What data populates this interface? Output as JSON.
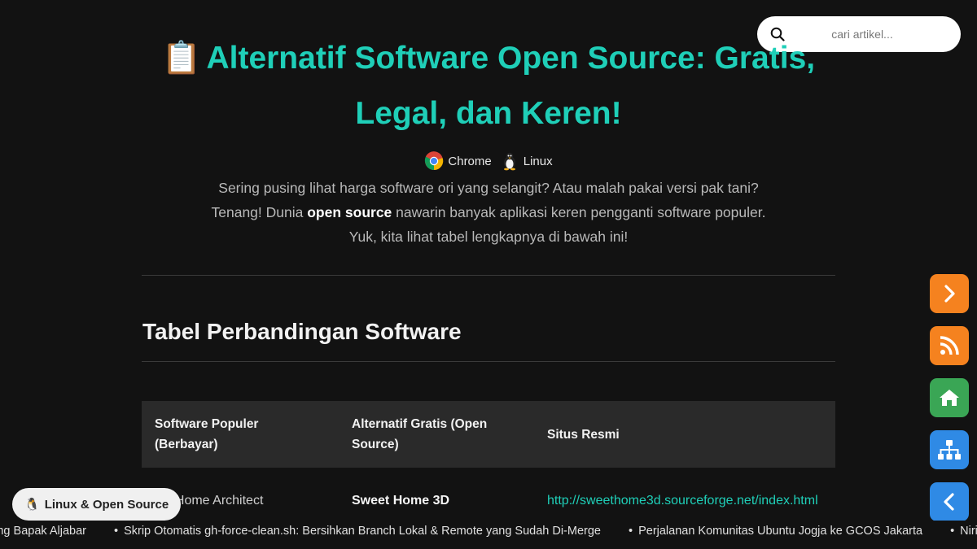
{
  "search": {
    "placeholder": "cari artikel..."
  },
  "page": {
    "title_emoji": "📋",
    "title": "Alternatif Software Open Source: Gratis, Legal, dan Keren!",
    "tags": [
      {
        "label": "Chrome",
        "icon": "chrome-icon"
      },
      {
        "label": "Linux",
        "icon": "tux-penguin-icon"
      }
    ],
    "intro_before": "Sering pusing lihat harga software ori yang selangit? Atau malah pakai versi pak tani? Tenang! Dunia ",
    "intro_bold": "open source",
    "intro_after": " nawarin banyak aplikasi keren pengganti software populer. Yuk, kita lihat tabel lengkapnya di bawah ini!",
    "section_title": "Tabel Perbandingan Software"
  },
  "table": {
    "headers": [
      "Software Populer (Berbayar)",
      "Alternatif Gratis (Open Source)",
      "Situs Resmi"
    ],
    "rows": [
      {
        "popular": "3D Home Architect",
        "alternative": "Sweet Home 3D",
        "site": "http://sweethome3d.sourceforge.net/index.html"
      }
    ]
  },
  "side_buttons": [
    {
      "name": "next-button",
      "icon": "chevron-right-icon",
      "color": "#f5821f"
    },
    {
      "name": "rss-button",
      "icon": "rss-icon",
      "color": "#f5821f"
    },
    {
      "name": "home-button",
      "icon": "home-icon",
      "color": "#3aa655"
    },
    {
      "name": "sitemap-button",
      "icon": "sitemap-icon",
      "color": "#2f8ae5"
    },
    {
      "name": "prev-button",
      "icon": "chevron-left-icon",
      "color": "#2f8ae5"
    }
  ],
  "category_pill": {
    "icon": "🐧",
    "label": "Linux & Open Source"
  },
  "ticker": [
    "Jadi Tukang Bapak Aljabar",
    "Skrip Otomatis gh-force-clean.sh: Bersihkan Branch Lokal & Remote yang Sudah Di-Merge",
    "Perjalanan Komunitas Ubuntu Jogja ke GCOS Jakarta",
    "Niri"
  ],
  "colors": {
    "accent": "#1fcfb8",
    "background": "#121212"
  }
}
